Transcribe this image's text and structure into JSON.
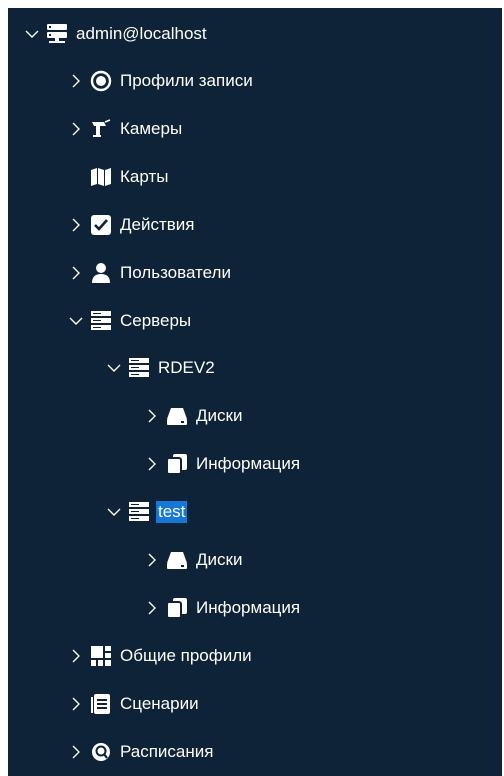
{
  "tree": {
    "root": {
      "label": "admin@localhost",
      "icon": "server-rack-icon",
      "expanded": true
    },
    "items": [
      {
        "label": "Профили записи",
        "icon": "record-circle-icon",
        "expanded": false
      },
      {
        "label": "Камеры",
        "icon": "security-camera-icon",
        "expanded": false
      },
      {
        "label": "Карты",
        "icon": "map-icon",
        "expanded": null
      },
      {
        "label": "Действия",
        "icon": "checkbox-icon",
        "expanded": false
      },
      {
        "label": "Пользователи",
        "icon": "user-icon",
        "expanded": false
      },
      {
        "label": "Серверы",
        "icon": "server-icon",
        "expanded": true,
        "children": [
          {
            "label": "RDEV2",
            "icon": "server-icon",
            "expanded": true,
            "children": [
              {
                "label": "Диски",
                "icon": "disk-drive-icon",
                "expanded": false
              },
              {
                "label": "Информация",
                "icon": "info-pages-icon",
                "expanded": false
              }
            ]
          },
          {
            "label": "test",
            "icon": "server-icon",
            "expanded": true,
            "selected": true,
            "children": [
              {
                "label": "Диски",
                "icon": "disk-drive-icon",
                "expanded": false
              },
              {
                "label": "Информация",
                "icon": "info-pages-icon",
                "expanded": false
              }
            ]
          }
        ]
      },
      {
        "label": "Общие профили",
        "icon": "grid-layout-icon",
        "expanded": false
      },
      {
        "label": "Сценарии",
        "icon": "document-list-icon",
        "expanded": false
      },
      {
        "label": "Расписания",
        "icon": "clock-search-icon",
        "expanded": false
      }
    ]
  },
  "colors": {
    "background": "#0e2238",
    "text": "#ffffff",
    "selection": "#1577d6",
    "icon": "#ffffff"
  }
}
